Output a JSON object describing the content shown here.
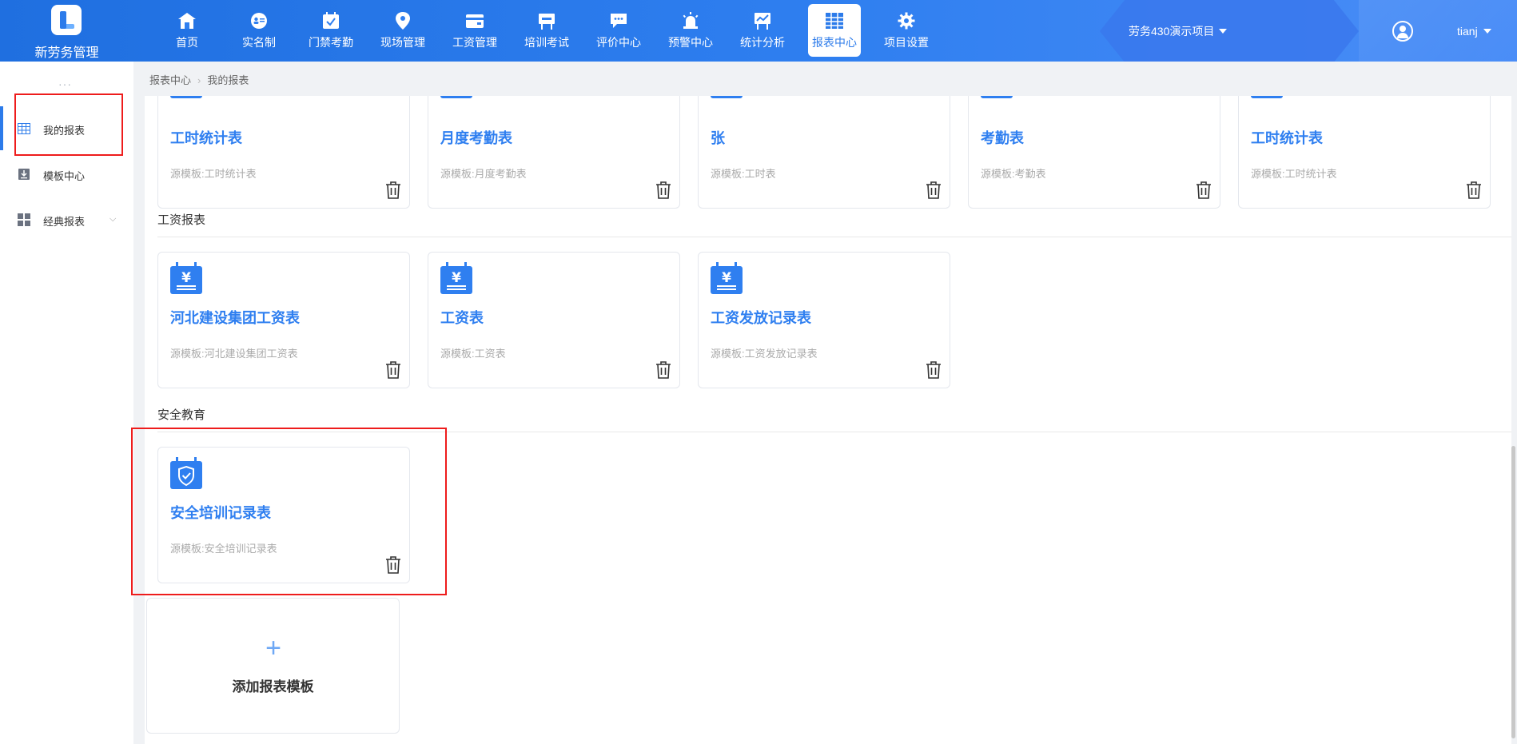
{
  "brand": {
    "name": "新劳务管理"
  },
  "nav": {
    "items": [
      {
        "label": "首页",
        "icon": "home-icon"
      },
      {
        "label": "实名制",
        "icon": "id-card-icon"
      },
      {
        "label": "门禁考勤",
        "icon": "calendar-check-icon"
      },
      {
        "label": "现场管理",
        "icon": "location-pin-icon"
      },
      {
        "label": "工资管理",
        "icon": "wallet-icon"
      },
      {
        "label": "培训考试",
        "icon": "easel-icon"
      },
      {
        "label": "评价中心",
        "icon": "chat-icon"
      },
      {
        "label": "预警中心",
        "icon": "alarm-icon"
      },
      {
        "label": "统计分析",
        "icon": "chart-board-icon"
      },
      {
        "label": "报表中心",
        "icon": "grid-table-icon",
        "active": true
      },
      {
        "label": "项目设置",
        "icon": "gear-icon"
      }
    ]
  },
  "header": {
    "project": "劳务430演示项目",
    "user": "tianj"
  },
  "sidebar": {
    "items": [
      {
        "label": "我的报表",
        "icon": "table-icon",
        "active": true
      },
      {
        "label": "模板中心",
        "icon": "download-icon"
      },
      {
        "label": "经典报表",
        "icon": "grid-icon",
        "expandable": true
      }
    ]
  },
  "breadcrumb": {
    "items": [
      "报表中心",
      "我的报表"
    ]
  },
  "sections": {
    "top_cards": [
      {
        "title": "工时统计表",
        "source": "源模板:工时统计表"
      },
      {
        "title": "月度考勤表",
        "source": "源模板:月度考勤表"
      },
      {
        "title": "张",
        "source": "源模板:工时表"
      },
      {
        "title": "考勤表",
        "source": "源模板:考勤表"
      },
      {
        "title": "工时统计表",
        "source": "源模板:工时统计表"
      }
    ],
    "salary": {
      "title": "工资报表",
      "cards": [
        {
          "title": "河北建设集团工资表",
          "source": "源模板:河北建设集团工资表"
        },
        {
          "title": "工资表",
          "source": "源模板:工资表"
        },
        {
          "title": "工资发放记录表",
          "source": "源模板:工资发放记录表"
        }
      ]
    },
    "safety": {
      "title": "安全教育",
      "cards": [
        {
          "title": "安全培训记录表",
          "source": "源模板:安全培训记录表"
        }
      ]
    }
  },
  "add_card": {
    "label": "添加报表模板"
  },
  "colors": {
    "primary": "#2c7bea",
    "highlight": "#ee1c1c"
  }
}
